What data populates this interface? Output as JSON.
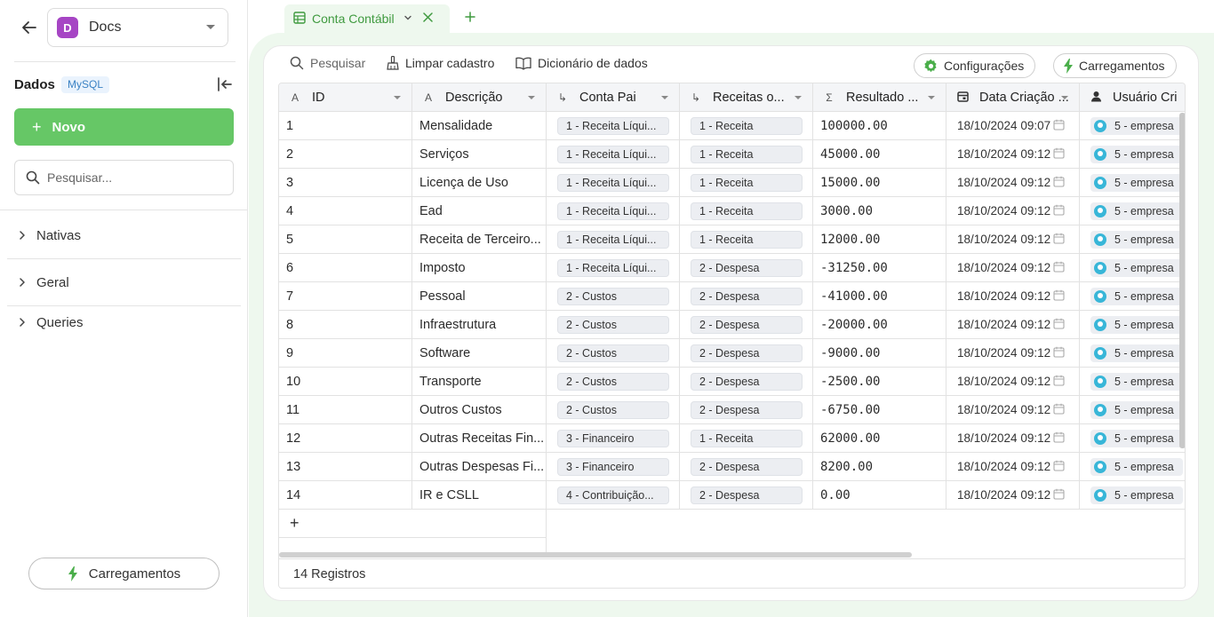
{
  "sidebar": {
    "project": {
      "initial": "D",
      "name": "Docs"
    },
    "dados_label": "Dados",
    "db_badge": "MySQL",
    "new_button": "Novo",
    "search_placeholder": "Pesquisar...",
    "tree": [
      "Nativas",
      "Geral",
      "Queries"
    ],
    "load_button": "Carregamentos"
  },
  "tabs": [
    {
      "label": "Conta Contábil"
    }
  ],
  "toolbar": {
    "search": "Pesquisar",
    "clear": "Limpar cadastro",
    "dictionary": "Dicionário de dados",
    "settings": "Configurações",
    "loads": "Carregamentos"
  },
  "grid": {
    "columns": [
      {
        "type_icon": "A",
        "label": "ID"
      },
      {
        "type_icon": "A",
        "label": "Descrição"
      },
      {
        "type_icon": "↳",
        "label": "Conta Pai"
      },
      {
        "type_icon": "↳",
        "label": "Receitas o..."
      },
      {
        "type_icon": "Σ",
        "label": "Resultado ..."
      },
      {
        "type_icon": "calendar",
        "label": "Data Criação ..."
      },
      {
        "type_icon": "user",
        "label": "Usuário Cri"
      }
    ],
    "rows": [
      {
        "id": "1",
        "desc": "Mensalidade",
        "conta_pai": "1 - Receita Líqui...",
        "receitas": "1 - Receita",
        "resultado": "100000.00",
        "data": "18/10/2024 09:07",
        "usuario": "5 - empresa"
      },
      {
        "id": "2",
        "desc": "Serviços",
        "conta_pai": "1 - Receita Líqui...",
        "receitas": "1 - Receita",
        "resultado": "45000.00",
        "data": "18/10/2024 09:12",
        "usuario": "5 - empresa"
      },
      {
        "id": "3",
        "desc": "Licença de Uso",
        "conta_pai": "1 - Receita Líqui...",
        "receitas": "1 - Receita",
        "resultado": "15000.00",
        "data": "18/10/2024 09:12",
        "usuario": "5 - empresa"
      },
      {
        "id": "4",
        "desc": "Ead",
        "conta_pai": "1 - Receita Líqui...",
        "receitas": "1 - Receita",
        "resultado": "3000.00",
        "data": "18/10/2024 09:12",
        "usuario": "5 - empresa"
      },
      {
        "id": "5",
        "desc": "Receita de Terceiro...",
        "conta_pai": "1 - Receita Líqui...",
        "receitas": "1 - Receita",
        "resultado": "12000.00",
        "data": "18/10/2024 09:12",
        "usuario": "5 - empresa"
      },
      {
        "id": "6",
        "desc": "Imposto",
        "conta_pai": "1 - Receita Líqui...",
        "receitas": "2 - Despesa",
        "resultado": "-31250.00",
        "data": "18/10/2024 09:12",
        "usuario": "5 - empresa"
      },
      {
        "id": "7",
        "desc": "Pessoal",
        "conta_pai": "2 - Custos",
        "receitas": "2 - Despesa",
        "resultado": "-41000.00",
        "data": "18/10/2024 09:12",
        "usuario": "5 - empresa"
      },
      {
        "id": "8",
        "desc": "Infraestrutura",
        "conta_pai": "2 - Custos",
        "receitas": "2 - Despesa",
        "resultado": "-20000.00",
        "data": "18/10/2024 09:12",
        "usuario": "5 - empresa"
      },
      {
        "id": "9",
        "desc": "Software",
        "conta_pai": "2 - Custos",
        "receitas": "2 - Despesa",
        "resultado": "-9000.00",
        "data": "18/10/2024 09:12",
        "usuario": "5 - empresa"
      },
      {
        "id": "10",
        "desc": "Transporte",
        "conta_pai": "2 - Custos",
        "receitas": "2 - Despesa",
        "resultado": "-2500.00",
        "data": "18/10/2024 09:12",
        "usuario": "5 - empresa"
      },
      {
        "id": "11",
        "desc": "Outros Custos",
        "conta_pai": "2 - Custos",
        "receitas": "2 - Despesa",
        "resultado": "-6750.00",
        "data": "18/10/2024 09:12",
        "usuario": "5 - empresa"
      },
      {
        "id": "12",
        "desc": "Outras Receitas Fin...",
        "conta_pai": "3 - Financeiro",
        "receitas": "1 - Receita",
        "resultado": "62000.00",
        "data": "18/10/2024 09:12",
        "usuario": "5 - empresa"
      },
      {
        "id": "13",
        "desc": "Outras Despesas Fi...",
        "conta_pai": "3 - Financeiro",
        "receitas": "2 - Despesa",
        "resultado": "8200.00",
        "data": "18/10/2024 09:12",
        "usuario": "5 - empresa"
      },
      {
        "id": "14",
        "desc": "IR e CSLL",
        "conta_pai": "4 - Contribuição...",
        "receitas": "2 - Despesa",
        "resultado": "0.00",
        "data": "18/10/2024 09:12",
        "usuario": "5 - empresa"
      }
    ],
    "add_row": "+",
    "footer": "14 Registros"
  },
  "colors": {
    "accent_green": "#66c766",
    "tab_green": "#3f9a3f",
    "mysql_badge": "#3b82c4",
    "project_badge": "#a645c4"
  }
}
